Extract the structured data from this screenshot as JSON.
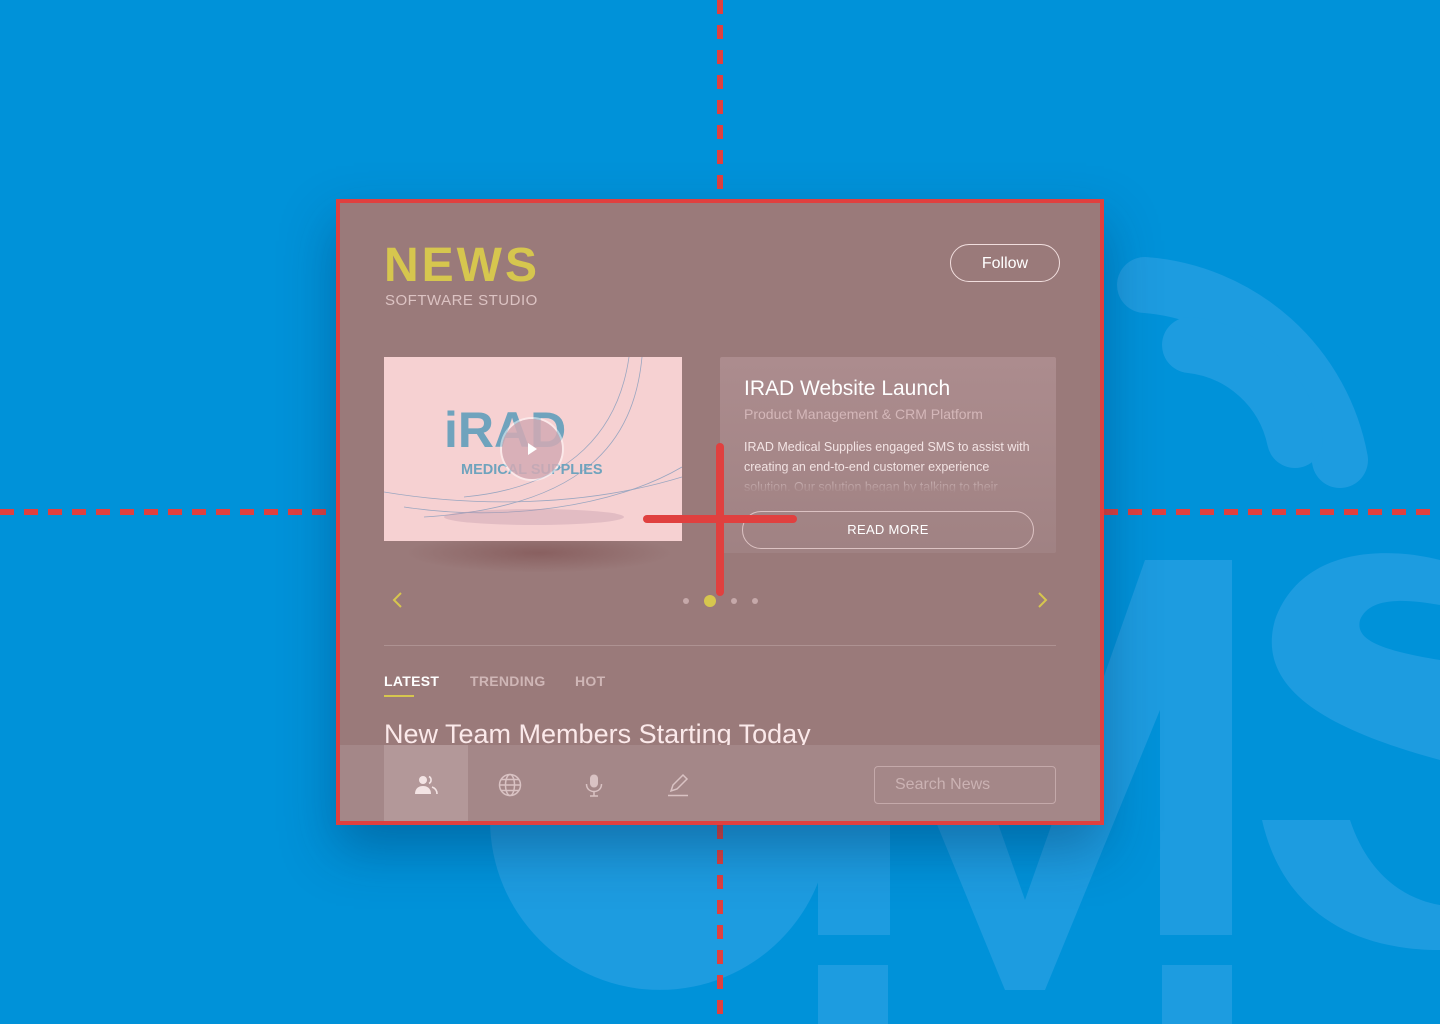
{
  "colors": {
    "background": "#0092d9",
    "card": "#9a7a7a",
    "accent": "#d6c64e",
    "guide": "#e0403f"
  },
  "background_watermark": {
    "icon": "wifi-icon",
    "text": "SMS"
  },
  "header": {
    "title": "NEWS",
    "subtitle": "SOFTWARE STUDIO",
    "follow_label": "Follow"
  },
  "featured": {
    "video": {
      "logo_top": "iRAD",
      "logo_bottom": "MEDICAL SUPPLIES",
      "play_icon": "play-icon"
    },
    "title": "IRAD Website Launch",
    "subtitle": "Product Management & CRM Platform",
    "body": "IRAD Medical Supplies engaged SMS to assist with creating an end-to-end customer experience solution. Our solution began by talking to their",
    "read_more_label": "READ MORE"
  },
  "carousel": {
    "prev_icon": "chevron-left-icon",
    "next_icon": "chevron-right-icon",
    "slide_count": 4,
    "active_index": 1
  },
  "tabs": [
    {
      "label": "LATEST",
      "active": true
    },
    {
      "label": "TRENDING",
      "active": false
    },
    {
      "label": "HOT",
      "active": false
    }
  ],
  "headline": "New Team Members Starting Today",
  "bottom_nav": {
    "items": [
      {
        "icon": "users-icon",
        "active": true
      },
      {
        "icon": "globe-icon",
        "active": false
      },
      {
        "icon": "microphone-icon",
        "active": false
      },
      {
        "icon": "pen-icon",
        "active": false
      }
    ],
    "search_placeholder": "Search News"
  }
}
